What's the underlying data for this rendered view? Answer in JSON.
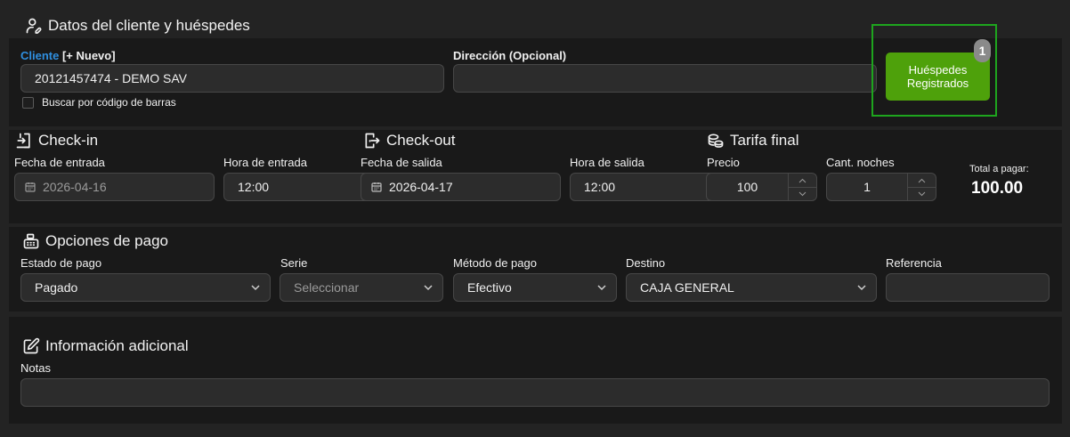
{
  "client_section": {
    "title": "Datos del cliente y huéspedes",
    "cliente_label": "Cliente",
    "nuevo_label": "[+ Nuevo]",
    "cliente_value": "20121457474 - DEMO SAV",
    "direccion_label": "Dirección (Opcional)",
    "direccion_value": "",
    "barcode_label": "Buscar por código de barras",
    "barcode_checked": false,
    "guests_button_label": "Huéspedes Registrados",
    "guests_count": "1"
  },
  "checkin": {
    "title": "Check-in",
    "fecha_label": "Fecha de entrada",
    "fecha_value": "2026-04-16",
    "hora_label": "Hora de entrada",
    "hora_value": "12:00"
  },
  "checkout": {
    "title": "Check-out",
    "fecha_label": "Fecha de salida",
    "fecha_value": "2026-04-17",
    "hora_label": "Hora de salida",
    "hora_value": "12:00"
  },
  "tarifa": {
    "title": "Tarifa final",
    "precio_label": "Precio",
    "precio_value": "100",
    "noches_label": "Cant. noches",
    "noches_value": "1",
    "total_label": "Total a pagar:",
    "total_value": "100.00"
  },
  "pago": {
    "title": "Opciones de pago",
    "estado_label": "Estado de pago",
    "estado_value": "Pagado",
    "serie_label": "Serie",
    "serie_value": "Seleccionar",
    "metodo_label": "Método de pago",
    "metodo_value": "Efectivo",
    "destino_label": "Destino",
    "destino_value": "CAJA GENERAL",
    "referencia_label": "Referencia",
    "referencia_value": ""
  },
  "adicional": {
    "title": "Información adicional",
    "notas_label": "Notas",
    "notas_value": ""
  },
  "colors": {
    "background": "#232323",
    "panel": "#191919",
    "field": "#2c2c2c",
    "accent_blue": "#2f8fe0",
    "button_green": "#4ea10b",
    "highlight_border": "#1ea51e",
    "badge": "#8a8a8a"
  },
  "icons": {
    "client": "user-edit-icon",
    "checkin": "door-enter-icon",
    "checkout": "door-exit-icon",
    "tarifa": "coins-icon",
    "pago": "cash-register-icon",
    "adicional": "edit-icon",
    "date": "calendar-icon",
    "select": "chevron-down-icon",
    "spinner": "spinner-arrows-icon"
  }
}
